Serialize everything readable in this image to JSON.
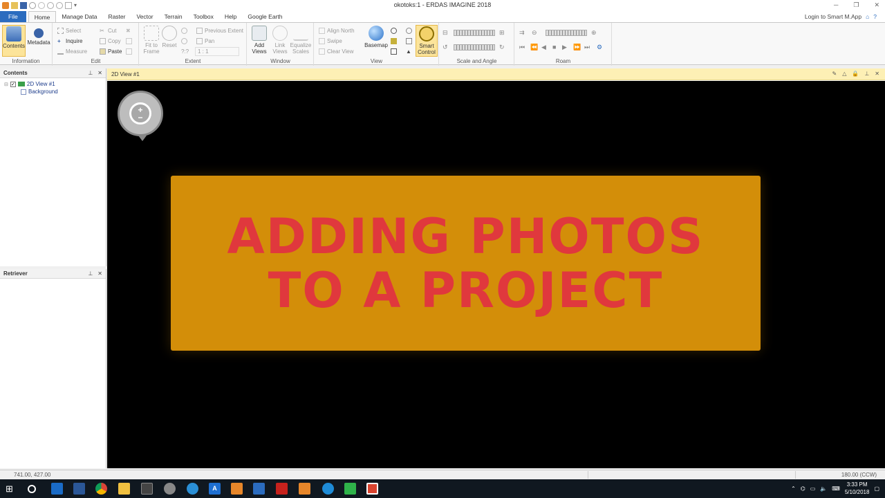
{
  "window": {
    "title": "okotoks:1 - ERDAS IMAGINE 2018",
    "login": "Login to Smart M.App"
  },
  "tabs": [
    "File",
    "Home",
    "Manage Data",
    "Raster",
    "Vector",
    "Terrain",
    "Toolbox",
    "Help",
    "Google Earth"
  ],
  "ribbon": {
    "information": {
      "label": "Information",
      "contents": "Contents",
      "metadata": "Metadata"
    },
    "edit": {
      "label": "Edit",
      "select": "Select",
      "inquire": "Inquire",
      "measure": "Measure",
      "cut": "Cut",
      "copy": "Copy",
      "paste": "Paste"
    },
    "extent": {
      "label": "Extent",
      "fit_to_frame": "Fit to Frame",
      "reset": "Reset",
      "previous_extent": "Previous Extent",
      "pan": "Pan",
      "scale_ratio": "1 : 1",
      "scale_prefix": "?:?"
    },
    "window": {
      "label": "Window",
      "add_views": "Add Views",
      "link_views": "Link Views",
      "equalize_scales": "Equalize Scales"
    },
    "view": {
      "label": "View",
      "align_north": "Align North",
      "swipe": "Swipe",
      "clear_view": "Clear View",
      "basemap": "Basemap",
      "smart_control": "Smart Control"
    },
    "scale_angle": {
      "label": "Scale and Angle"
    },
    "roam": {
      "label": "Roam"
    }
  },
  "contents_panel": {
    "title": "Contents",
    "items": [
      {
        "label": "2D View #1",
        "checked": true
      },
      {
        "label": "Background",
        "checked": false
      }
    ]
  },
  "retriever_panel": {
    "title": "Retriever"
  },
  "view": {
    "tab_label": "2D View #1",
    "banner_text": "Adding Photos to a Project",
    "banner_color": "#d38e09",
    "text_color": "#e0383d"
  },
  "status": {
    "coords": "741.00, 427.00",
    "rotation": "180.00 (CCW)"
  },
  "taskbar": {
    "time": "3:33 PM",
    "date": "5/10/2018"
  }
}
